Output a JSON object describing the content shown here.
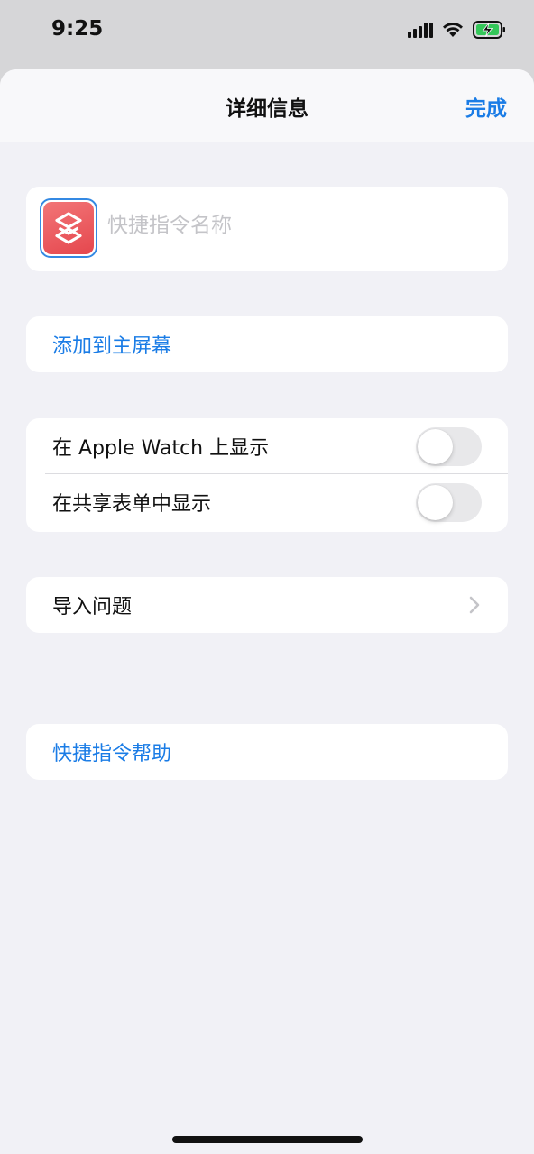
{
  "status_bar": {
    "time": "9:25",
    "icons": [
      "cellular-signal-icon",
      "wifi-icon",
      "battery-charging-icon"
    ],
    "battery_color": "#34c759"
  },
  "nav": {
    "title": "详细信息",
    "done_label": "完成"
  },
  "shortcut": {
    "icon": "shortcuts-app-icon",
    "name_value": "",
    "name_placeholder": "快捷指令名称"
  },
  "rows": {
    "add_to_home": "添加到主屏幕",
    "show_on_watch": "在 Apple Watch 上显示",
    "show_on_watch_enabled": false,
    "show_in_share_sheet": "在共享表单中显示",
    "show_in_share_sheet_enabled": false,
    "import_questions": "导入问题",
    "help": "快捷指令帮助"
  },
  "colors": {
    "accent": "#1a7ce6",
    "background": "#f1f1f6",
    "icon_red": "#e9575c"
  }
}
